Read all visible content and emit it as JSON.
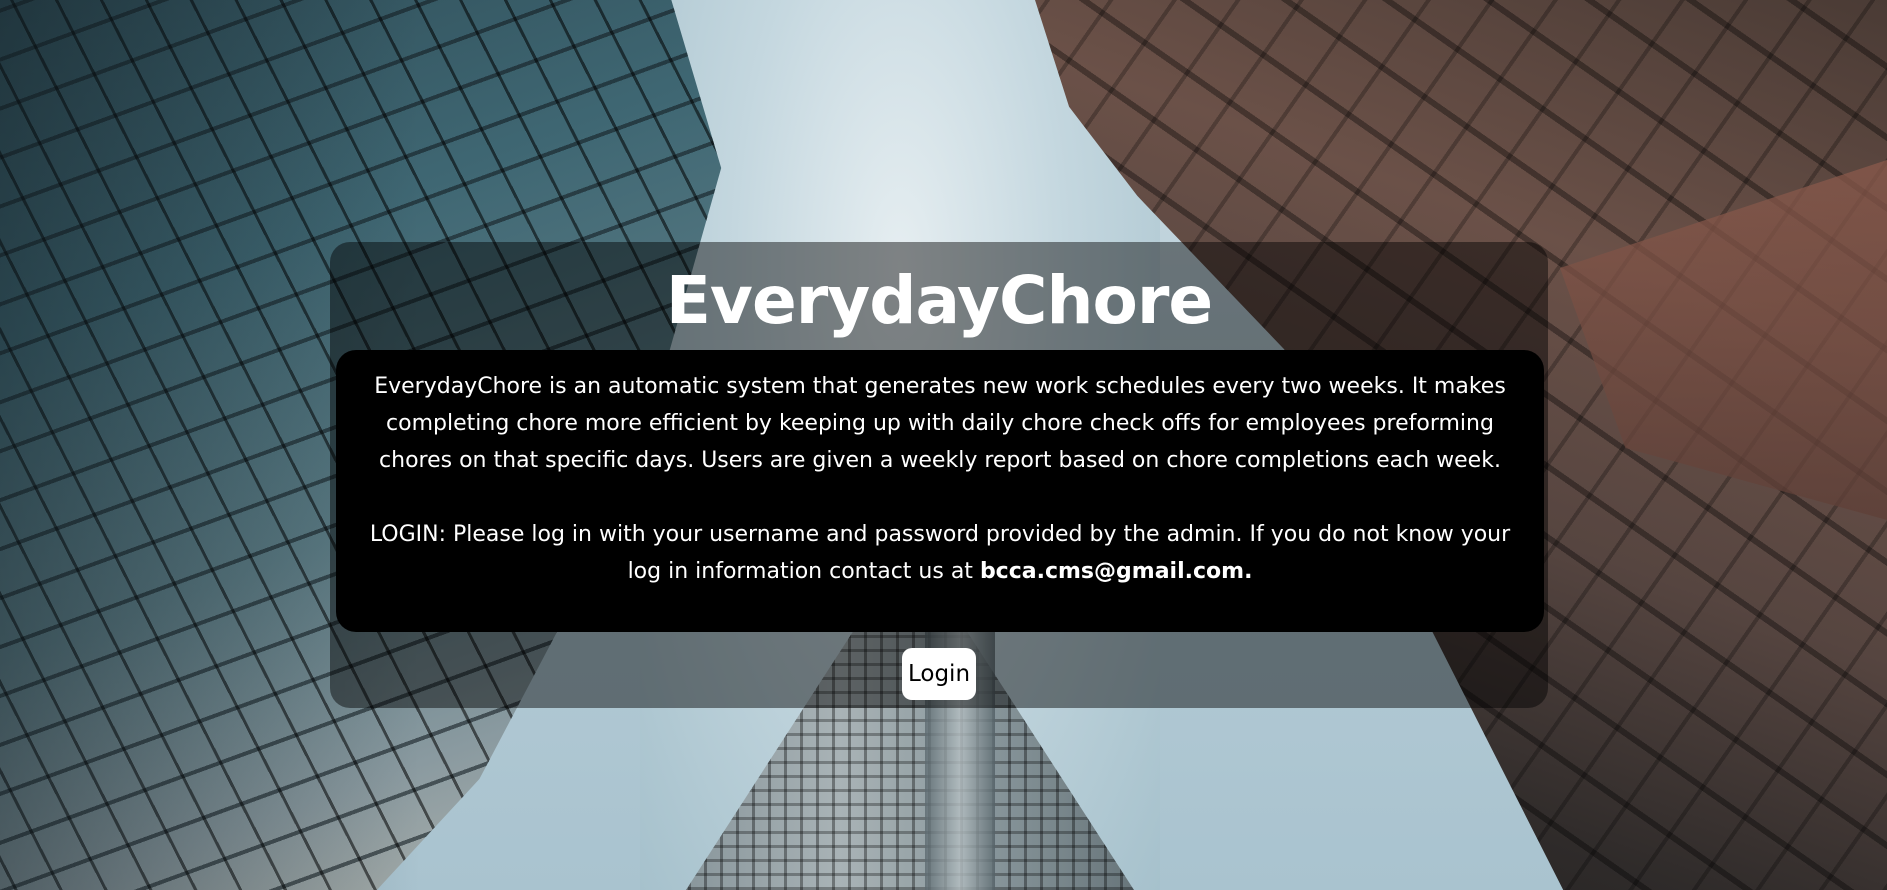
{
  "app": {
    "title": "EverydayChore"
  },
  "intro": {
    "description": "EverydayChore is an automatic system that generates new work schedules every two weeks. It makes completing chore more efficient by keeping up with daily chore check offs for employees preforming chores on that specific days. Users are given a weekly report based on chore completions each week.",
    "login_instructions": "LOGIN: Please log in with your username and password provided by the admin. If you do not know your log in information contact us at",
    "contact_email": "bcca.cms@gmail.com."
  },
  "actions": {
    "login_label": "Login"
  },
  "colors": {
    "panel_overlay": "rgba(0,0,0,0.45)",
    "description_box": "#000000",
    "text": "#ffffff",
    "button_bg": "#ffffff",
    "button_text": "#000000"
  }
}
